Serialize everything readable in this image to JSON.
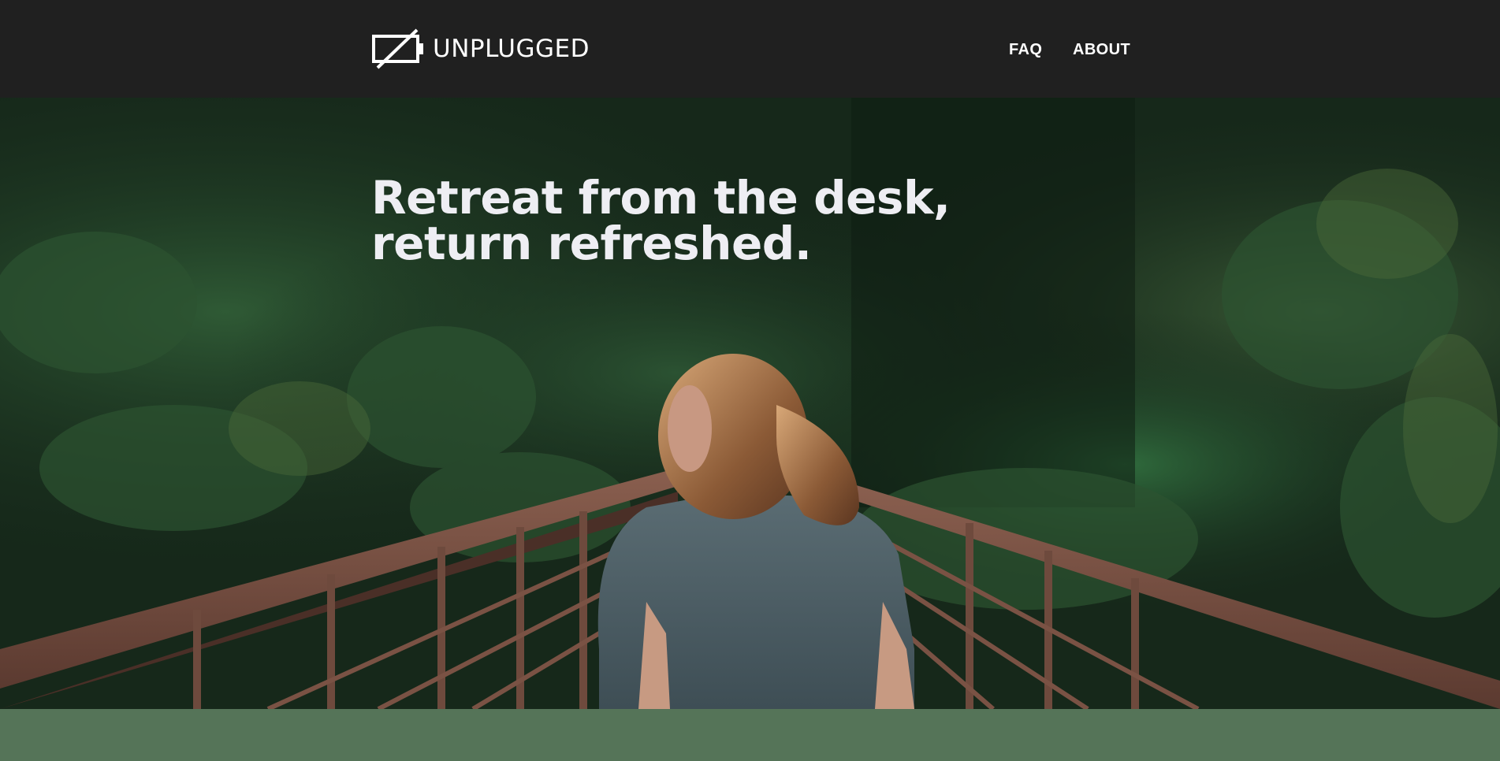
{
  "header": {
    "logo_icon": "unplugged-battery-icon",
    "logo_text": "UNPLUGGED",
    "nav": [
      {
        "label": "FAQ"
      },
      {
        "label": "ABOUT"
      }
    ]
  },
  "hero": {
    "heading_line1": "Retreat from the desk,",
    "heading_line2": "return refreshed."
  },
  "colors": {
    "header_bg": "#202020",
    "header_text": "#ffffff",
    "heading_text": "#eeeef3",
    "band_bg": "#557458"
  }
}
